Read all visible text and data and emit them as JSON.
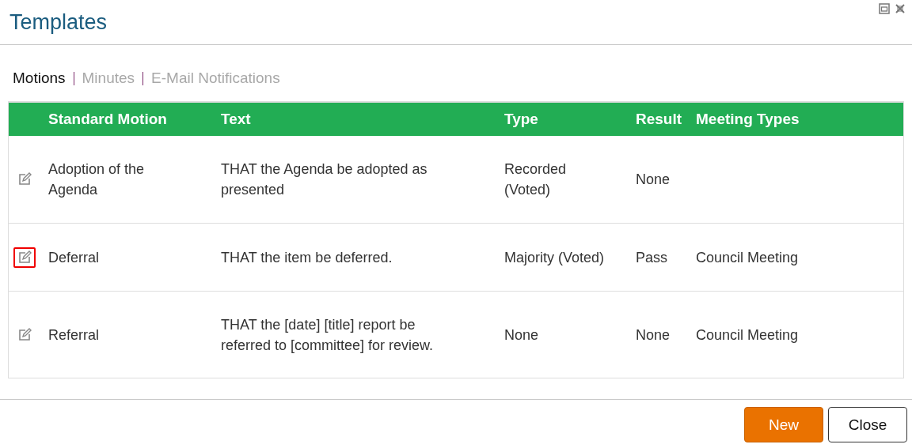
{
  "window": {
    "title": "Templates"
  },
  "tabs": [
    {
      "label": "Motions",
      "selected": true
    },
    {
      "label": "Minutes",
      "selected": false
    },
    {
      "label": "E-Mail Notifications",
      "selected": false
    }
  ],
  "table": {
    "columns": [
      "Standard Motion",
      "Text",
      "Type",
      "Result",
      "Meeting Types"
    ],
    "rows": [
      {
        "highlighted": false,
        "cells": [
          "Adoption of the Agenda",
          "THAT the Agenda be adopted as presented",
          "Recorded (Voted)",
          "None",
          ""
        ]
      },
      {
        "highlighted": true,
        "cells": [
          "Deferral",
          "THAT the item be deferred.",
          "Majority (Voted)",
          "Pass",
          "Council Meeting"
        ]
      },
      {
        "highlighted": false,
        "cells": [
          "Referral",
          "THAT the [date] [title] report be referred to [committee] for review.",
          "None",
          "None",
          "Council Meeting"
        ]
      }
    ]
  },
  "buttons": [
    {
      "label": "New",
      "kind": "primary"
    },
    {
      "label": "Close",
      "kind": "secondary"
    }
  ]
}
